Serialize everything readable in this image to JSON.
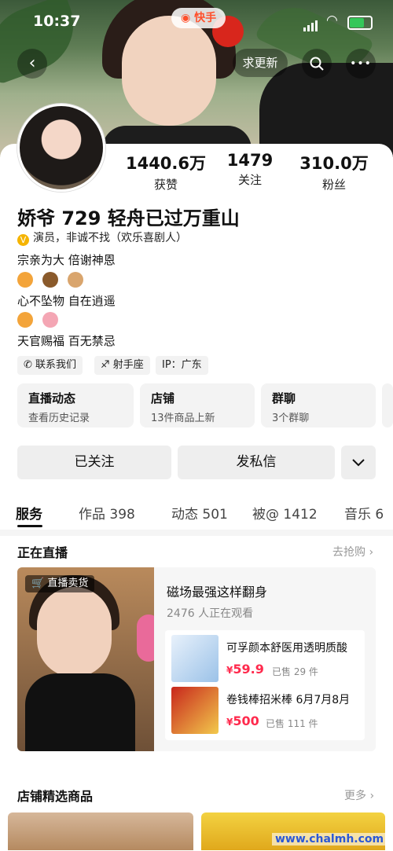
{
  "status": {
    "time": "10:37",
    "app_pill": "快手"
  },
  "header": {
    "update_button": "求更新",
    "back_icon": "‹",
    "search_icon": "⌕",
    "more_icon": "•••"
  },
  "profile": {
    "stats": [
      {
        "value": "1440.6万",
        "label": "获赞"
      },
      {
        "value": "1479",
        "label": "关注"
      },
      {
        "value": "310.0万",
        "label": "粉丝"
      }
    ],
    "nickname": "娇爷 729 轻舟已过万重山",
    "verification": "演员，非诚不找（欢乐喜剧人）",
    "bio": {
      "line1": "宗亲为大 倍谢神恩",
      "line2": "心不坠物 自在逍遥",
      "line3": "天官赐福 百无禁忌"
    },
    "tags": [
      {
        "label": "联系我们",
        "icon": "phone-icon"
      },
      {
        "label": "射手座",
        "icon": "sagittarius-icon"
      },
      {
        "label": "IP：广东"
      }
    ]
  },
  "features": [
    {
      "title": "直播动态",
      "subtitle": "查看历史记录"
    },
    {
      "title": "店铺",
      "subtitle": "13件商品上新"
    },
    {
      "title": "群聊",
      "subtitle": "3个群聊"
    }
  ],
  "actions": {
    "follow": "已关注",
    "message": "发私信",
    "dropdown_icon": "chevron-down-icon"
  },
  "tabs": [
    "服务",
    "作品 398",
    "动态 501",
    "被@ 1412",
    "音乐 6"
  ],
  "live": {
    "section_title": "正在直播",
    "more": "去抢购",
    "badge": "直播卖货",
    "title": "磁场最强这样翻身",
    "viewers": "2476 人正在观看",
    "products": [
      {
        "name": "可孚颜本舒医用透明质酸",
        "price": "59.9",
        "sold": "已售 29 件"
      },
      {
        "name": "卷钱棒招米棒 6月7月8月",
        "price": "500",
        "sold": "已售 111 件"
      }
    ]
  },
  "shop": {
    "section_title": "店铺精选商品",
    "more": "更多"
  },
  "watermark": "www.chalmh.com",
  "colors": {
    "price": "#ff2a4d",
    "kuaishou": "#ff4f2b",
    "verify": "#f5b400"
  }
}
